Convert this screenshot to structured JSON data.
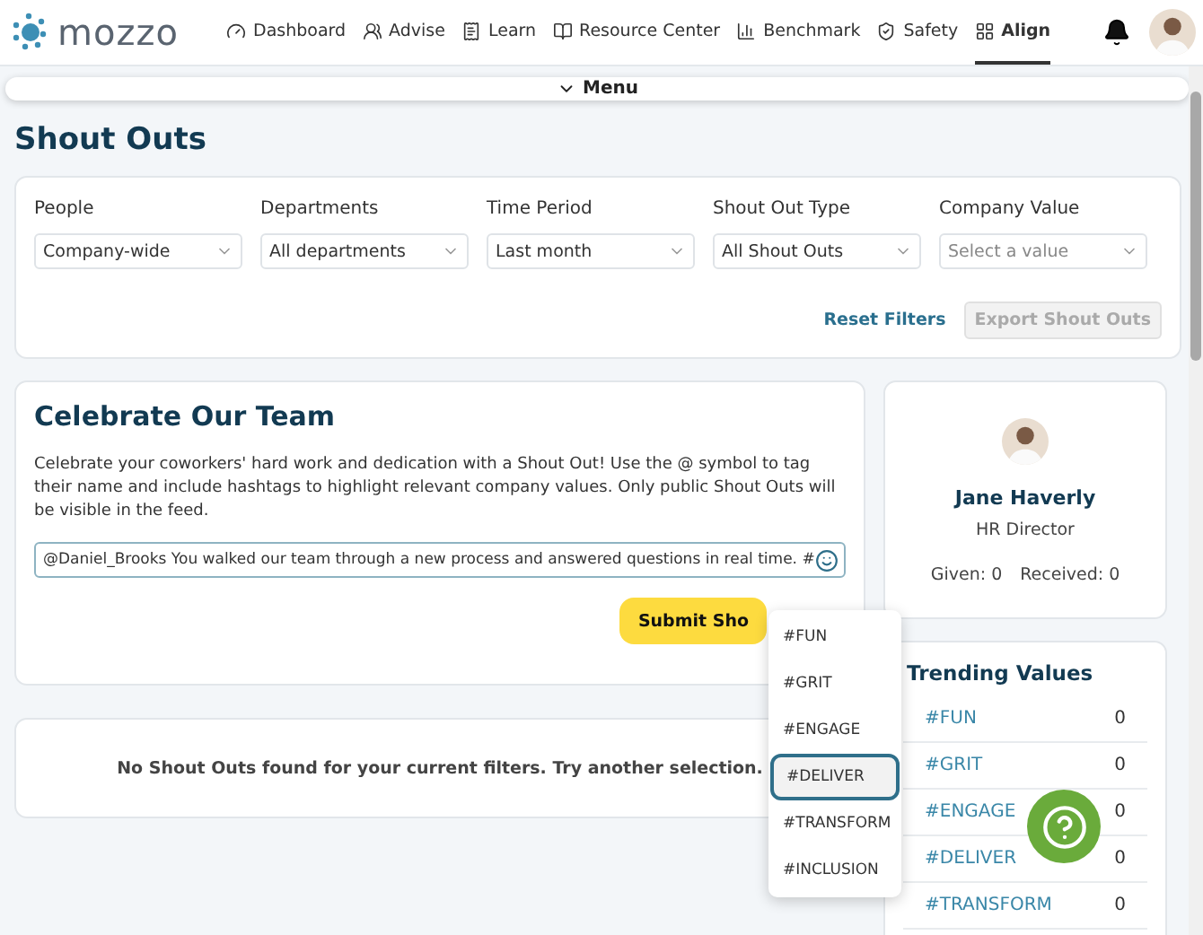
{
  "header": {
    "logo": "mozzo",
    "nav": [
      {
        "label": "Dashboard",
        "selected": false
      },
      {
        "label": "Advise",
        "selected": false
      },
      {
        "label": "Learn",
        "selected": false
      },
      {
        "label": "Resource Center",
        "selected": false
      },
      {
        "label": "Benchmark",
        "selected": false
      },
      {
        "label": "Safety",
        "selected": false
      },
      {
        "label": "Align",
        "selected": true
      }
    ]
  },
  "menu_bar": {
    "label": "Menu"
  },
  "page_title": "Shout Outs",
  "filters": [
    {
      "label": "People",
      "value": "Company-wide"
    },
    {
      "label": "Departments",
      "value": "All departments"
    },
    {
      "label": "Time Period",
      "value": "Last month"
    },
    {
      "label": "Shout Out Type",
      "value": "All Shout Outs"
    },
    {
      "label": "Company Value",
      "placeholder": "Select a value"
    }
  ],
  "filter_actions": {
    "reset": "Reset Filters",
    "export": {
      "label": "Export Shout Outs",
      "disabled": true
    }
  },
  "celebrate": {
    "title": "Celebrate Our Team",
    "description": "Celebrate your coworkers' hard work and dedication with a Shout Out! Use the @ symbol to tag their name and include hashtags to highlight relevant company values. Only public Shout Outs will be visible in the feed.",
    "message": "@Daniel_Brooks You walked our team through a new process and answered questions in real time. #",
    "submit": "Submit Sho"
  },
  "hashtag_menu": [
    {
      "label": "#FUN",
      "selected": false
    },
    {
      "label": "#GRIT",
      "selected": false
    },
    {
      "label": "#ENGAGE",
      "selected": false
    },
    {
      "label": "#DELIVER",
      "selected": true
    },
    {
      "label": "#TRANSFORM",
      "selected": false
    },
    {
      "label": "#INCLUSION",
      "selected": false
    }
  ],
  "empty_message": "No Shout Outs found for your current filters. Try another selection.",
  "profile": {
    "name": "Jane Haverly",
    "role": "HR Director",
    "given": "Given: 0",
    "received": "Received: 0"
  },
  "trending": {
    "title": "Trending Values",
    "rows": [
      {
        "value": "#FUN",
        "count": "0"
      },
      {
        "value": "#GRIT",
        "count": "0"
      },
      {
        "value": "#ENGAGE",
        "count": "0"
      },
      {
        "value": "#DELIVER",
        "count": "0"
      },
      {
        "value": "#TRANSFORM",
        "count": "0"
      }
    ]
  }
}
